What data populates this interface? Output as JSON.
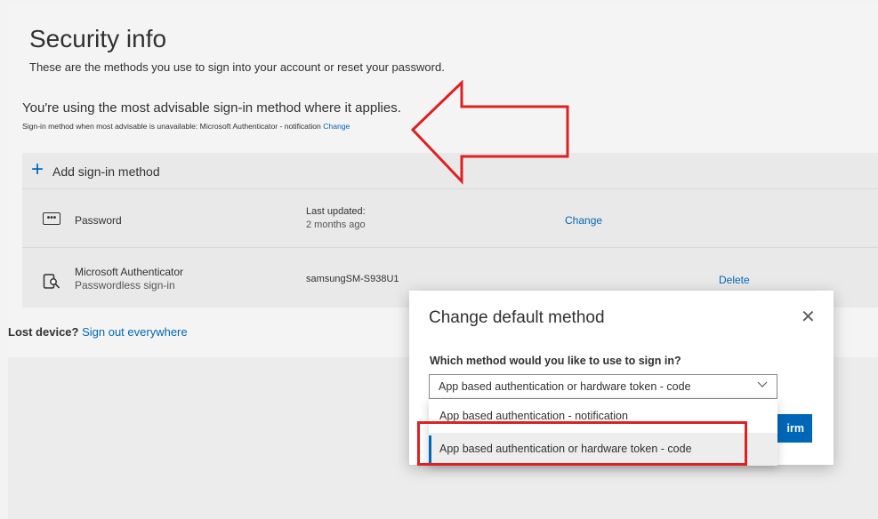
{
  "page": {
    "title": "Security info",
    "subtitle": "These are the methods you use to sign into your account or reset your password.",
    "advisable": "You're using the most advisable sign-in method where it applies.",
    "fallback_text": "Sign-in method when most advisable is unavailable: Microsoft Authenticator - notification ",
    "fallback_change": "Change"
  },
  "methods": {
    "add_label": "Add sign-in method",
    "password": {
      "label": "Password",
      "updated_label": "Last updated:",
      "updated_value": "2 months ago",
      "action": "Change"
    },
    "authenticator": {
      "label": "Microsoft Authenticator",
      "sub": "Passwordless sign-in",
      "device": "samsungSM-S938U1",
      "action": "Delete"
    }
  },
  "lost": {
    "bold": "Lost device?",
    "link": "Sign out everywhere"
  },
  "dialog": {
    "title": "Change default method",
    "close": "✕",
    "question": "Which method would you like to use to sign in?",
    "selected": "App based authentication or hardware token - code",
    "confirm_partial": "irm",
    "options": [
      "App based authentication - notification",
      "App based authentication or hardware token - code"
    ]
  },
  "colors": {
    "accent": "#0067b8",
    "annotation": "#e02020"
  }
}
